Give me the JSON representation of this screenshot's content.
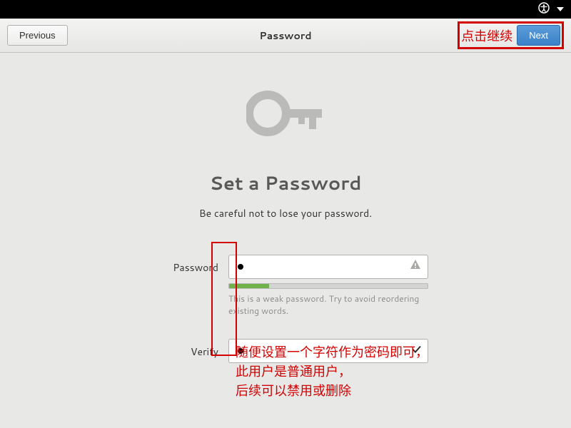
{
  "header": {
    "previous_label": "Previous",
    "title": "Password",
    "next_label": "Next"
  },
  "annot": {
    "click_continue": "点击继续",
    "line1": "随便设置一个字符作为密码即可，",
    "line2": "此用户是普通用户，",
    "line3": "后续可以禁用或删除"
  },
  "main": {
    "heading": "Set a Password",
    "subheading": "Be careful not to lose your password.",
    "password_label": "Password",
    "verify_label": "Verify",
    "hint": "This is a weak password. Try to avoid reordering existing words."
  }
}
